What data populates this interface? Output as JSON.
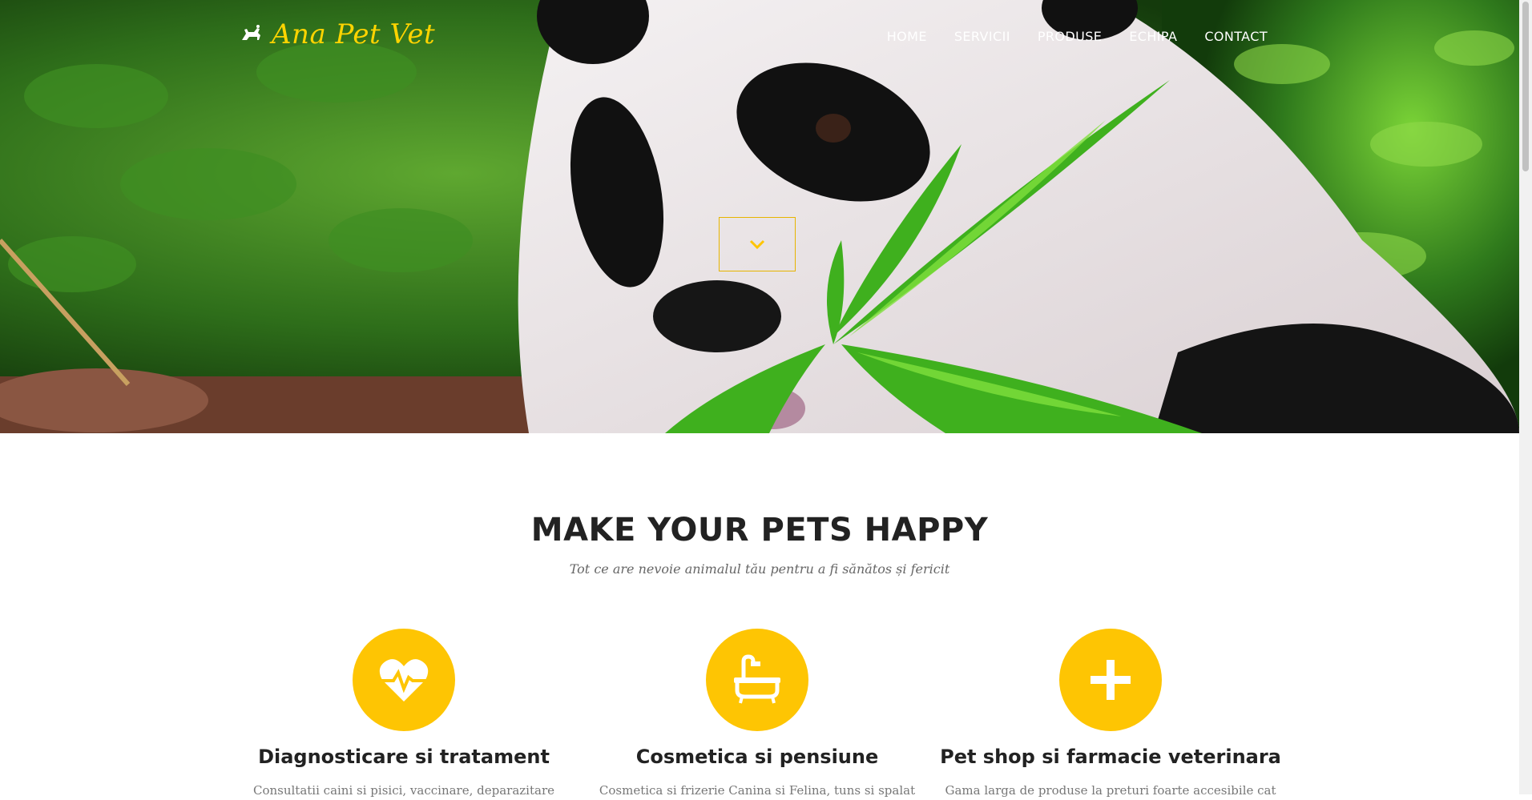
{
  "brand": {
    "name": "Ana Pet Vet",
    "icon": "dog-cat-icon"
  },
  "nav": {
    "items": [
      {
        "label": "HOME"
      },
      {
        "label": "SERVICII"
      },
      {
        "label": "PRODUSE"
      },
      {
        "label": "ECHIPA"
      },
      {
        "label": "CONTACT"
      }
    ]
  },
  "hero": {
    "scroll_icon": "chevron-down-icon"
  },
  "section": {
    "title": "MAKE YOUR PETS HAPPY",
    "subtitle": "Tot ce are nevoie animalul tău pentru a fi sănătos și fericit"
  },
  "services": [
    {
      "icon": "heartbeat-icon",
      "title": "Diagnosticare si tratament",
      "text": "Consultatii caini si pisici, vaccinare, deparazitare"
    },
    {
      "icon": "bathtub-icon",
      "title": "Cosmetica si pensiune",
      "text": "Cosmetica si frizerie Canina si Felina, tuns si spalat"
    },
    {
      "icon": "plus-icon",
      "title": "Pet shop si farmacie veterinara",
      "text": "Gama larga de produse la preturi foarte accesibile cat"
    }
  ],
  "colors": {
    "accent": "#fec503",
    "brand": "#ffd400",
    "heading": "#222222",
    "muted": "#777777"
  }
}
